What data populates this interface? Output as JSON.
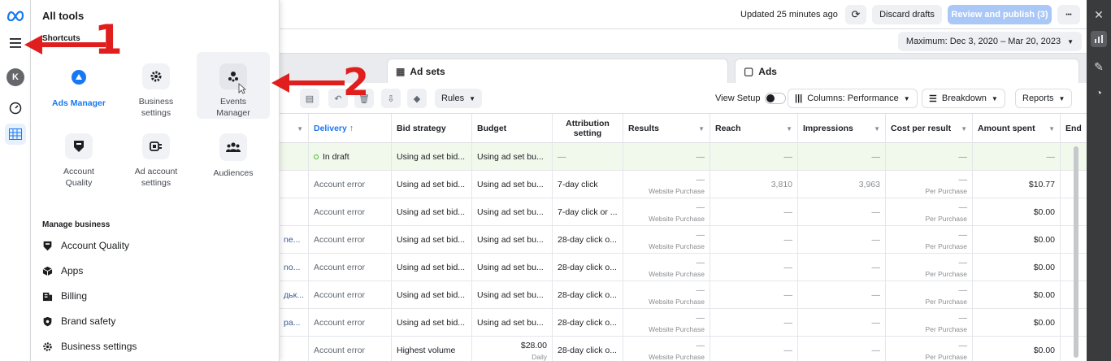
{
  "topbar": {
    "updated": "Updated 25 minutes ago",
    "discard": "Discard drafts",
    "publish": "Review and publish (3)",
    "more": "•••",
    "date_range": "Maximum: Dec 3, 2020 – Mar 20, 2023"
  },
  "tabs": {
    "adsets": "Ad sets",
    "ads": "Ads"
  },
  "toolbar": {
    "rules": "Rules",
    "view_setup": "View Setup",
    "columns": "Columns: Performance",
    "breakdown": "Breakdown",
    "reports": "Reports"
  },
  "table": {
    "headers": [
      "Delivery ↑",
      "Bid strategy",
      "Budget",
      "Attribution setting",
      "Results",
      "Reach",
      "Impressions",
      "Cost per result",
      "Amount spent",
      "End"
    ],
    "rows": [
      {
        "name": "",
        "delivery": "In draft",
        "bid": "Using ad set bid...",
        "budget": "Using ad set bu...",
        "budget_sub": "",
        "attr": "—",
        "results": "—",
        "results_sub": "",
        "reach": "—",
        "impr": "—",
        "cpr": "—",
        "cpr_sub": "",
        "spent": "—"
      },
      {
        "name": "",
        "delivery": "Account error",
        "bid": "Using ad set bid...",
        "budget": "Using ad set bu...",
        "budget_sub": "",
        "attr": "7-day click",
        "results": "—",
        "results_sub": "Website Purchase",
        "reach": "3,810",
        "impr": "3,963",
        "cpr": "—",
        "cpr_sub": "Per Purchase",
        "spent": "$10.77"
      },
      {
        "name": "",
        "delivery": "Account error",
        "bid": "Using ad set bid...",
        "budget": "Using ad set bu...",
        "budget_sub": "",
        "attr": "7-day click or ...",
        "results": "—",
        "results_sub": "Website Purchase",
        "reach": "—",
        "impr": "—",
        "cpr": "—",
        "cpr_sub": "Per Purchase",
        "spent": "$0.00"
      },
      {
        "name": "ne...",
        "delivery": "Account error",
        "bid": "Using ad set bid...",
        "budget": "Using ad set bu...",
        "budget_sub": "",
        "attr": "28-day click o...",
        "results": "—",
        "results_sub": "Website Purchase",
        "reach": "—",
        "impr": "—",
        "cpr": "—",
        "cpr_sub": "Per Purchase",
        "spent": "$0.00"
      },
      {
        "name": "no...",
        "delivery": "Account error",
        "bid": "Using ad set bid...",
        "budget": "Using ad set bu...",
        "budget_sub": "",
        "attr": "28-day click o...",
        "results": "—",
        "results_sub": "Website Purchase",
        "reach": "—",
        "impr": "—",
        "cpr": "—",
        "cpr_sub": "Per Purchase",
        "spent": "$0.00"
      },
      {
        "name": "дьк...",
        "delivery": "Account error",
        "bid": "Using ad set bid...",
        "budget": "Using ad set bu...",
        "budget_sub": "",
        "attr": "28-day click o...",
        "results": "—",
        "results_sub": "Website Purchase",
        "reach": "—",
        "impr": "—",
        "cpr": "—",
        "cpr_sub": "Per Purchase",
        "spent": "$0.00"
      },
      {
        "name": "pa...",
        "delivery": "Account error",
        "bid": "Using ad set bid...",
        "budget": "Using ad set bu...",
        "budget_sub": "",
        "attr": "28-day click o...",
        "results": "—",
        "results_sub": "Website Purchase",
        "reach": "—",
        "impr": "—",
        "cpr": "—",
        "cpr_sub": "Per Purchase",
        "spent": "$0.00"
      },
      {
        "name": "",
        "delivery": "Account error",
        "bid": "Highest volume",
        "budget": "$28.00",
        "budget_sub": "Daily",
        "attr": "28-day click o...",
        "results": "—",
        "results_sub": "Website Purchase",
        "reach": "—",
        "impr": "—",
        "cpr": "—",
        "cpr_sub": "Per Purchase",
        "spent": "$0.00"
      }
    ]
  },
  "panel": {
    "title": "All tools",
    "shortcuts": "Shortcuts",
    "tools": [
      {
        "label": "Ads Manager",
        "icon": "ads-manager-icon"
      },
      {
        "label": "Business\nsettings",
        "icon": "gear-icon"
      },
      {
        "label": "Events\nManager",
        "icon": "events-manager-icon"
      },
      {
        "label": "Account\nQuality",
        "icon": "shield-icon"
      },
      {
        "label": "Ad account\nsettings",
        "icon": "ad-account-icon"
      },
      {
        "label": "Audiences",
        "icon": "people-icon"
      }
    ],
    "manage_title": "Manage business",
    "manage_items": [
      "Account Quality",
      "Apps",
      "Billing",
      "Brand safety",
      "Business settings"
    ]
  },
  "rail": {
    "avatar": "K"
  },
  "annotations": {
    "one": "1",
    "two": "2",
    "color": "#e01e1e"
  },
  "colors": {
    "accent": "#1877f2",
    "publish": "#a9c8f7",
    "draft_row": "#f1f8ec",
    "draft_dot": "#42b72a"
  }
}
